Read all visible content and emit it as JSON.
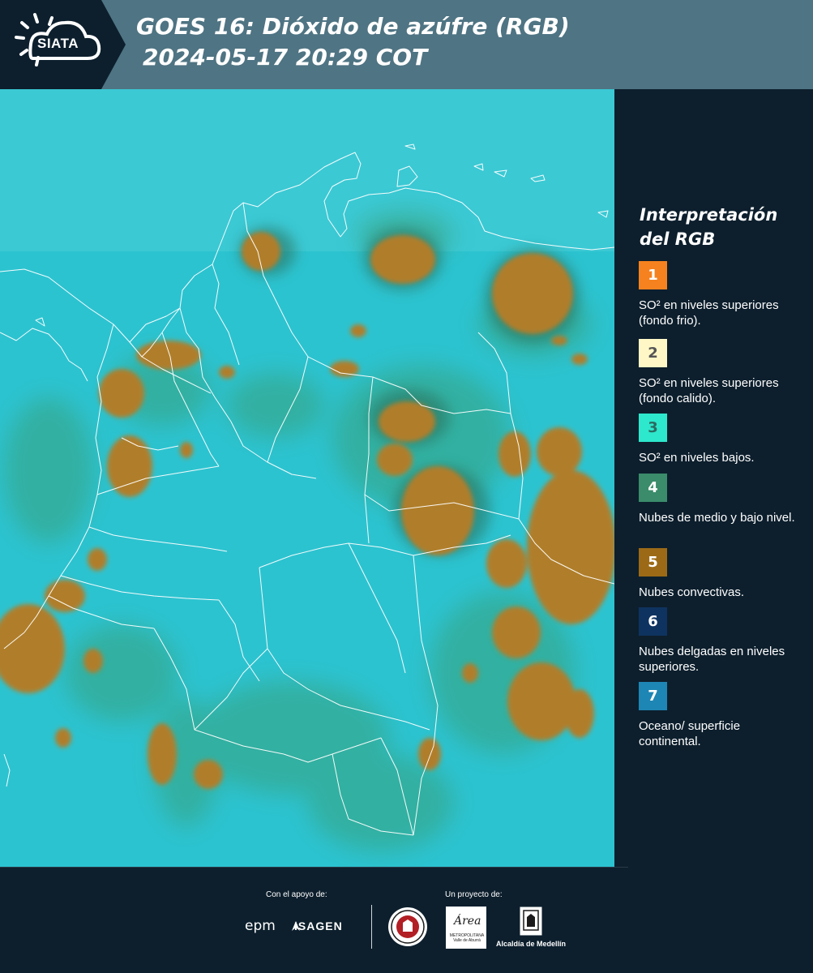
{
  "header": {
    "logo_text": "SIATA",
    "title_line1": "GOES 16: Dióxido de azúfre (RGB)",
    "title_line2": "2024-05-17 20:29 COT"
  },
  "legend": {
    "title": "Interpretación del RGB",
    "items": [
      {
        "number": "1",
        "color": "#f5821f",
        "text_color": "#ffffff",
        "label": "SO² en niveles superiores (fondo frio)."
      },
      {
        "number": "2",
        "color": "#fff8c6",
        "text_color": "#555555",
        "label": "SO² en niveles superiores (fondo calido)."
      },
      {
        "number": "3",
        "color": "#2de8cc",
        "text_color": "#2a6b63",
        "label": "SO² en niveles bajos."
      },
      {
        "number": "4",
        "color": "#3a8c6a",
        "text_color": "#ffffff",
        "label": "Nubes de medio y bajo nivel."
      },
      {
        "number": "5",
        "color": "#9c6a16",
        "text_color": "#ffffff",
        "label": "Nubes convectivas."
      },
      {
        "number": "6",
        "color": "#0e3360",
        "text_color": "#ffffff",
        "label": "Nubes delgadas en niveles superiores."
      },
      {
        "number": "7",
        "color": "#1e86b4",
        "text_color": "#ffffff",
        "label": "Oceano/ superficie continental."
      }
    ]
  },
  "footer": {
    "support_label": "Con el apoyo de:",
    "project_label": "Un proyecto de:",
    "sponsor_1": "epm",
    "sponsor_2": "ISAGEN",
    "area_logo_text": "Área",
    "area_logo_sub": "METROPOLITANA Valle de Aburrá",
    "alcaldia_label": "Alcaldía de Medellín"
  },
  "colors": {
    "header_bg": "#4f7483",
    "panel_bg": "#0d1f2d",
    "map_background": "#2cc3d0",
    "convective_cloud": "#b07e2a",
    "low_cloud": "#3f9a63",
    "border_lines": "#ffffff"
  }
}
